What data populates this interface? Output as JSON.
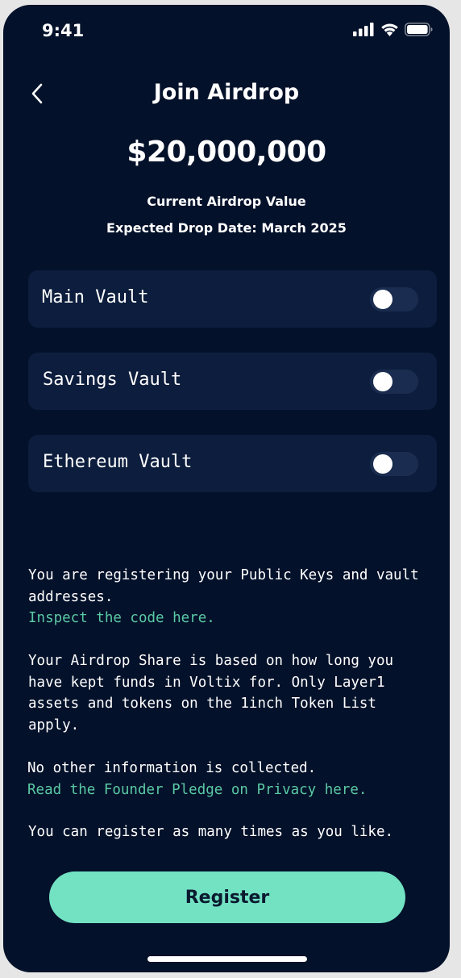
{
  "status_bar": {
    "time": "9:41",
    "icons": [
      "signal-icon",
      "wifi-icon",
      "battery-icon"
    ]
  },
  "header": {
    "title": "Join Airdrop",
    "back_icon": "chevron-left-icon"
  },
  "airdrop": {
    "amount": "$20,000,000",
    "value_label": "Current Airdrop Value",
    "drop_date": "Expected Drop Date: March 2025"
  },
  "vaults": [
    {
      "label": "Main Vault",
      "enabled": false
    },
    {
      "label": "Savings Vault",
      "enabled": false
    },
    {
      "label": "Ethereum Vault",
      "enabled": false
    }
  ],
  "info": {
    "registering_line1": "You are registering your Public Keys and vault",
    "registering_line2": "addresses.",
    "inspect_link": "Inspect the code here.",
    "share_lines": [
      "Your Airdrop Share is based on how long you",
      "have kept funds in Voltix for. Only Layer1",
      "assets and tokens on the 1inch Token List",
      "apply."
    ],
    "no_info": "No other information is collected.",
    "pledge_link": "Read the Founder Pledge on Privacy here.",
    "register_many": "You can register as many times as you like."
  },
  "register_button": {
    "label": "Register"
  },
  "colors": {
    "background": "#04112a",
    "card": "#0d1d3d",
    "accent": "#73e2c3",
    "link": "#5ac9a4"
  }
}
